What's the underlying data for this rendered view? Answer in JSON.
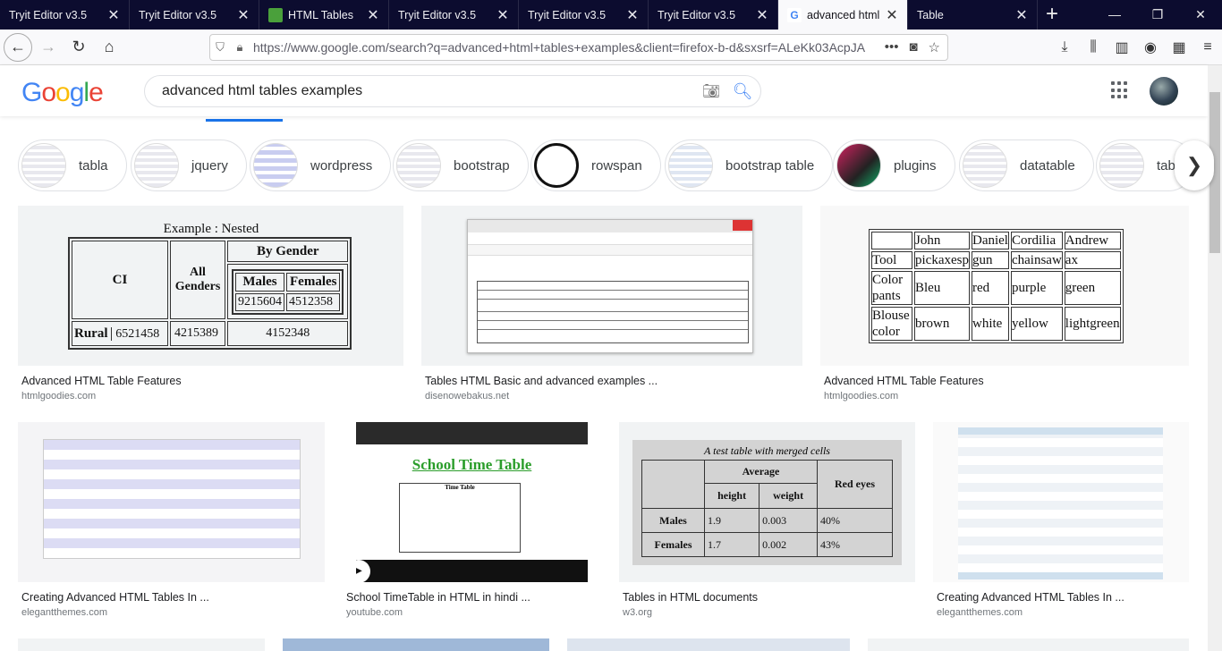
{
  "browser": {
    "tabs": [
      {
        "label": "Tryit Editor v3.5",
        "icon": "none"
      },
      {
        "label": "Tryit Editor v3.5",
        "icon": "none"
      },
      {
        "label": "HTML Tables",
        "icon": "html-tables-favicon"
      },
      {
        "label": "Tryit Editor v3.5",
        "icon": "none"
      },
      {
        "label": "Tryit Editor v3.5",
        "icon": "none"
      },
      {
        "label": "Tryit Editor v3.5",
        "icon": "none"
      },
      {
        "label": "advanced html",
        "icon": "google-favicon",
        "active": true
      },
      {
        "label": "Table",
        "icon": "none"
      }
    ],
    "url": "https://www.google.com/search?q=advanced+html+tables+examples&client=firefox-b-d&sxsrf=ALeKk03AcpJA"
  },
  "google": {
    "logo": "Google",
    "query": "advanced html tables examples"
  },
  "chips": [
    {
      "label": "tabla"
    },
    {
      "label": "jquery"
    },
    {
      "label": "wordpress"
    },
    {
      "label": "bootstrap"
    },
    {
      "label": "rowspan"
    },
    {
      "label": "bootstrap table"
    },
    {
      "label": "plugins"
    },
    {
      "label": "datatable"
    },
    {
      "label": "tab"
    }
  ],
  "results": [
    {
      "title": "Advanced HTML Table Features",
      "source": "htmlgoodies.com"
    },
    {
      "title": "Tables HTML Basic and advanced examples ...",
      "source": "disenowebakus.net"
    },
    {
      "title": "Advanced HTML Table Features",
      "source": "htmlgoodies.com"
    },
    {
      "title": "Creating Advanced HTML Tables In ...",
      "source": "elegantthemes.com"
    },
    {
      "title": "School TimeTable in HTML in hindi ...",
      "source": "youtube.com"
    },
    {
      "title": "Tables in HTML documents",
      "source": "w3.org"
    },
    {
      "title": "Creating Advanced HTML Tables In ...",
      "source": "elegantthemes.com"
    }
  ],
  "img1": {
    "caption": "Example : Nested",
    "ci": "CI",
    "all_genders": "All Genders",
    "by_gender": "By Gender",
    "males": "Males",
    "females": "Females",
    "m_val": "9215604",
    "f_val": "4512358",
    "rural": "Rural",
    "r1": "6521458",
    "r2": "4215389",
    "r3": "4152348"
  },
  "img3": {
    "header": [
      "",
      "John",
      "Daniel",
      "Cordilia",
      "Andrew"
    ],
    "rows": [
      [
        "Tool",
        "pickaxesp",
        "gun",
        "chainsaw",
        "ax"
      ],
      [
        "Color pants",
        "Bleu",
        "red",
        "purple",
        "green"
      ],
      [
        "Blouse color",
        "brown",
        "white",
        "yellow",
        "lightgreen"
      ]
    ]
  },
  "img5": {
    "heading": "School Time Table",
    "sub": "Time Table"
  },
  "img6": {
    "caption": "A test table with merged cells",
    "average": "Average",
    "red_eyes": "Red eyes",
    "height": "height",
    "weight": "weight",
    "rows": [
      [
        "Males",
        "1.9",
        "0.003",
        "40%"
      ],
      [
        "Females",
        "1.7",
        "0.002",
        "43%"
      ]
    ]
  }
}
